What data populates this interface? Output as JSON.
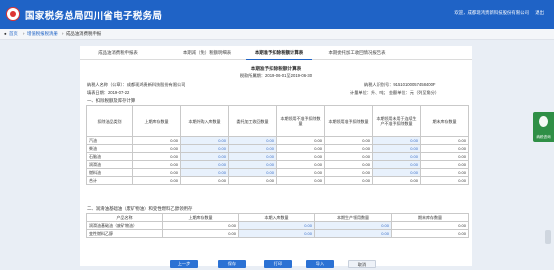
{
  "header": {
    "site_title": "国家税务总局四川省电子税务局",
    "welcome": "欢迎，成都现鸿贵新科技股份有限公司",
    "exit": "退出"
  },
  "breadcrumb": {
    "home": "首页",
    "level1": "增值税报税清册",
    "level2": "成品油消费税申报"
  },
  "tabs": [
    "成品油消费税申报表",
    "本期减（免）税额明细表",
    "本期准予扣除税额计算表",
    "本期委托加工收回情况报告表"
  ],
  "active_tab": 2,
  "report": {
    "title": "本期准予扣除税额计算表",
    "period": "税款所属期：2019-06-01至2019-06-30",
    "taxpayer_name": "纳税人名称（公章）：成都现鸿贵新科技股份有限公司",
    "taxpayer_id": "纳税人识别号：91510100057458400F",
    "fill_date": "填表日期：2019-07-22",
    "unit": "计量单位：升、吨；  金额单位：元（列至角分）"
  },
  "section1": {
    "title": "一、扣除税额及库存计算",
    "headers": [
      "扣除油品类别",
      "上期库存数量",
      "本期外购入库数量",
      "委托加工收回数量",
      "本期领用不准予扣除数量",
      "本期领用准予扣除数量",
      "本期领用未用于连续生产不准予扣除数量",
      "期末库存数量"
    ],
    "rows": [
      {
        "name": "汽油",
        "v": [
          "0.00",
          "0.00",
          "0.00",
          "0.00",
          "0.00",
          "0.00",
          "0.00"
        ]
      },
      {
        "name": "柴油",
        "v": [
          "0.00",
          "0.00",
          "0.00",
          "0.00",
          "0.00",
          "0.00",
          "0.00"
        ]
      },
      {
        "name": "石脑油",
        "v": [
          "0.00",
          "0.00",
          "0.00",
          "0.00",
          "0.00",
          "0.00",
          "0.00"
        ]
      },
      {
        "name": "润滑油",
        "v": [
          "0.00",
          "0.00",
          "0.00",
          "0.00",
          "0.00",
          "0.00",
          "0.00"
        ]
      },
      {
        "name": "燃料油",
        "v": [
          "0.00",
          "0.00",
          "0.00",
          "0.00",
          "0.00",
          "0.00",
          "0.00"
        ]
      },
      {
        "name": "合计",
        "v": [
          "0.00",
          "0.00",
          "0.00",
          "0.00",
          "0.00",
          "0.00",
          "0.00"
        ]
      }
    ]
  },
  "section2": {
    "title": "二、润滑油基础油（废矿物油）和变性燃料乙醇领用存",
    "headers": [
      "产品名称",
      "上期库存数量",
      "本期入库数量",
      "本期生产领用数量",
      "期末库存数量"
    ],
    "rows": [
      {
        "name": "润滑油基础油（废矿物油）",
        "v": [
          "0.00",
          "0.00",
          "0.00",
          "0.00"
        ]
      },
      {
        "name": "变性燃料乙醇",
        "v": [
          "0.00",
          "0.00",
          "0.00",
          "0.00"
        ]
      }
    ]
  },
  "buttons": {
    "prev": "上一步",
    "save": "保存",
    "print": "打印",
    "import": "导入",
    "cancel": "取消"
  },
  "side_widget": {
    "label": "纳税咨询"
  }
}
